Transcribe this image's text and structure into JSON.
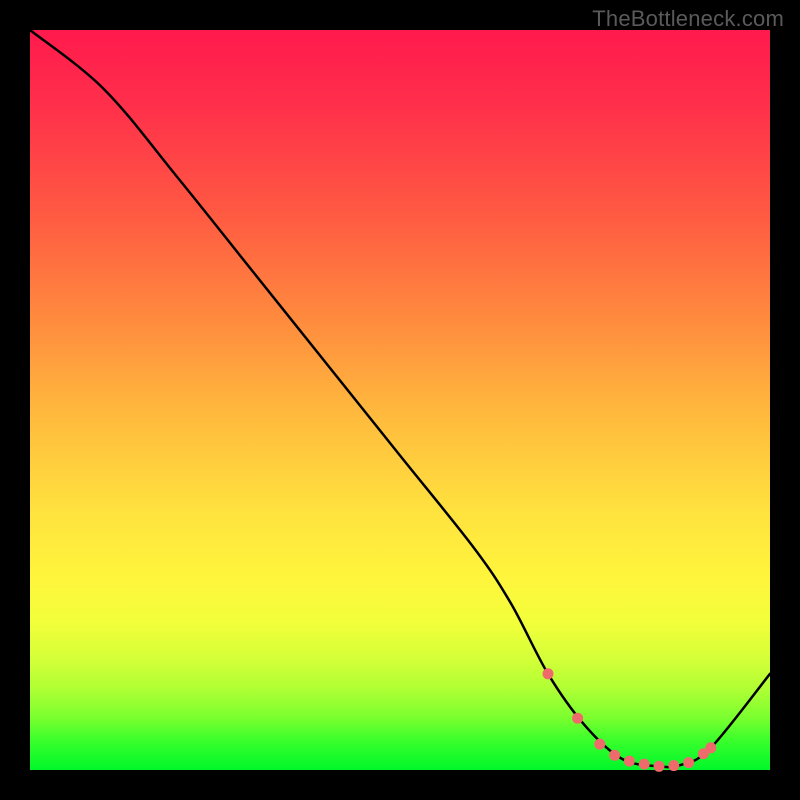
{
  "watermark": {
    "text": "TheBottleneck.com"
  },
  "colors": {
    "curve_stroke": "#000000",
    "marker_fill": "#ef6b6b",
    "marker_stroke": "#d65656"
  },
  "chart_data": {
    "type": "line",
    "title": "",
    "xlabel": "",
    "ylabel": "",
    "xlim": [
      0,
      100
    ],
    "ylim": [
      0,
      100
    ],
    "series": [
      {
        "name": "bottleneck-curve",
        "x": [
          0,
          10,
          20,
          30,
          40,
          50,
          60,
          65,
          70,
          75,
          80,
          85,
          88,
          92,
          100
        ],
        "values": [
          100,
          92,
          80,
          67.5,
          55,
          42.5,
          30,
          22.5,
          13,
          6,
          1.5,
          0.5,
          0.7,
          3,
          13
        ]
      }
    ],
    "markers": {
      "name": "highlighted-points",
      "x": [
        70,
        74,
        77,
        79,
        81,
        83,
        85,
        87,
        89,
        91,
        92
      ],
      "values": [
        13,
        7,
        3.5,
        2,
        1.2,
        0.8,
        0.5,
        0.6,
        1.0,
        2.2,
        3
      ]
    }
  }
}
